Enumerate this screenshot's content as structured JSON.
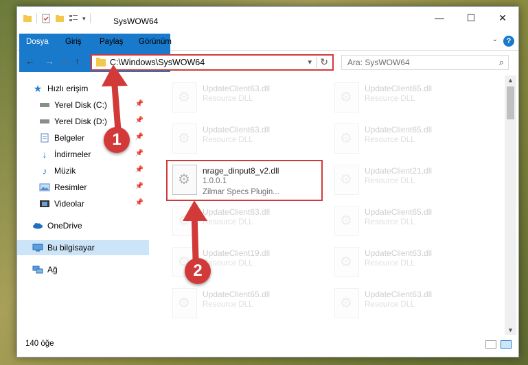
{
  "window": {
    "title": "SysWOW64",
    "controls": [
      "—",
      "☐",
      "✕"
    ]
  },
  "ribbon": {
    "tabs": [
      "Dosya",
      "Giriş",
      "Paylaş",
      "Görünüm"
    ],
    "help": "?"
  },
  "nav": {
    "address": "C:\\Windows\\SysWOW64",
    "search_placeholder": "Ara: SysWOW64"
  },
  "sidebar": {
    "items": [
      {
        "label": "Hızlı erişim",
        "icon": "star-icon"
      },
      {
        "label": "Yerel Disk (C:)",
        "icon": "drive-icon"
      },
      {
        "label": "Yerel Disk (D:)",
        "icon": "drive-icon"
      },
      {
        "label": "Belgeler",
        "icon": "documents-icon"
      },
      {
        "label": "İndirmeler",
        "icon": "download-icon"
      },
      {
        "label": "Müzik",
        "icon": "music-icon"
      },
      {
        "label": "Resimler",
        "icon": "pictures-icon"
      },
      {
        "label": "Videolar",
        "icon": "video-icon"
      },
      {
        "label": "OneDrive",
        "icon": "cloud-icon"
      },
      {
        "label": "Bu bilgisayar",
        "icon": "computer-icon"
      },
      {
        "label": "Ağ",
        "icon": "network-icon"
      }
    ]
  },
  "files": [
    {
      "name": "UpdateClient63.dll",
      "line1": "Resource DLL",
      "line2": ""
    },
    {
      "name": "UpdateClient65.dll",
      "line1": "Resource DLL",
      "line2": ""
    },
    {
      "name": "UpdateClient63.dll",
      "line1": "Resource DLL",
      "line2": ""
    },
    {
      "name": "UpdateClient65.dll",
      "line1": "Resource DLL",
      "line2": ""
    },
    {
      "name": "nrage_dinput8_v2.dll",
      "line1": "1.0.0.1",
      "line2": "Zilmar Specs Plugin..."
    },
    {
      "name": "UpdateClient21.dll",
      "line1": "Resource DLL",
      "line2": ""
    },
    {
      "name": "UpdateClient63.dll",
      "line1": "Resource DLL",
      "line2": ""
    },
    {
      "name": "UpdateClient65.dll",
      "line1": "Resource DLL",
      "line2": ""
    },
    {
      "name": "UpdateClient19.dll",
      "line1": "Resource DLL",
      "line2": ""
    },
    {
      "name": "UpdateClient63.dll",
      "line1": "Resource DLL",
      "line2": ""
    },
    {
      "name": "UpdateClient65.dll",
      "line1": "Resource DLL",
      "line2": ""
    },
    {
      "name": "UpdateClient63.dll",
      "line1": "Resource DLL",
      "line2": ""
    }
  ],
  "status": {
    "count": "140 öğe"
  },
  "callouts": [
    "1",
    "2"
  ],
  "colors": {
    "accent": "#1979ca",
    "highlight": "#d23a3a",
    "selected": "#cce4f7"
  }
}
